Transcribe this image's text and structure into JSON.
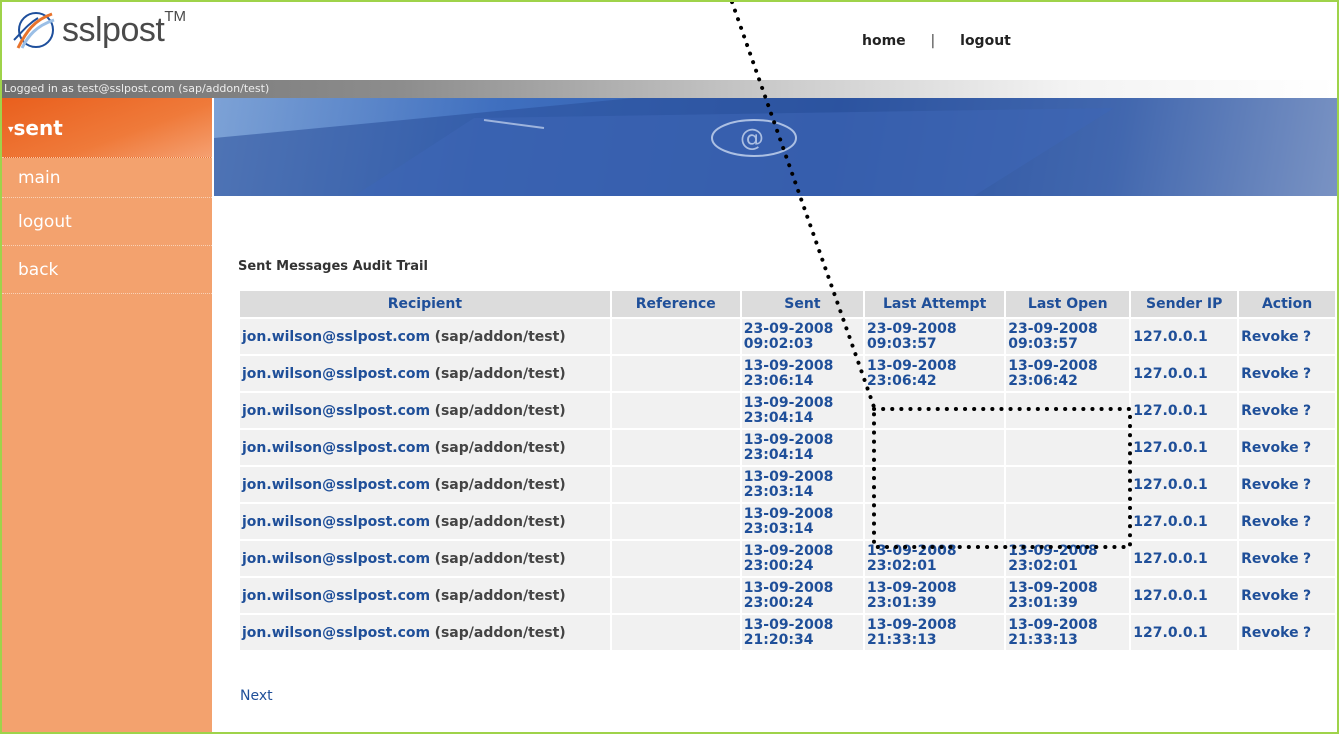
{
  "header": {
    "logo_text": "sslpost",
    "logo_tm": "TM",
    "nav": {
      "home": "home",
      "separator": "|",
      "logout": "logout"
    }
  },
  "login_bar": {
    "text": "Logged in as test@sslpost.com (sap/addon/test)"
  },
  "sidebar": {
    "current": "sent",
    "items": [
      {
        "label": "main"
      },
      {
        "label": "logout"
      },
      {
        "label": "back"
      }
    ]
  },
  "content": {
    "title": "Sent Messages Audit Trail",
    "columns": [
      "Recipient",
      "Reference",
      "Sent",
      "Last Attempt",
      "Last Open",
      "Sender IP",
      "Action"
    ],
    "rows": [
      {
        "email": "jon.wilson@sslpost.com",
        "tag": "(sap/addon/test)",
        "reference": "",
        "sent_date": "23-09-2008",
        "sent_time": "09:02:03",
        "la_date": "23-09-2008",
        "la_time": "09:03:57",
        "lo_date": "23-09-2008",
        "lo_time": "09:03:57",
        "ip": "127.0.0.1",
        "action": "Revoke",
        "help": "?"
      },
      {
        "email": "jon.wilson@sslpost.com",
        "tag": "(sap/addon/test)",
        "reference": "",
        "sent_date": "13-09-2008",
        "sent_time": "23:06:14",
        "la_date": "13-09-2008",
        "la_time": "23:06:42",
        "lo_date": "13-09-2008",
        "lo_time": "23:06:42",
        "ip": "127.0.0.1",
        "action": "Revoke",
        "help": "?"
      },
      {
        "email": "jon.wilson@sslpost.com",
        "tag": "(sap/addon/test)",
        "reference": "",
        "sent_date": "13-09-2008",
        "sent_time": "23:04:14",
        "la_date": "",
        "la_time": "",
        "lo_date": "",
        "lo_time": "",
        "ip": "127.0.0.1",
        "action": "Revoke",
        "help": "?"
      },
      {
        "email": "jon.wilson@sslpost.com",
        "tag": "(sap/addon/test)",
        "reference": "",
        "sent_date": "13-09-2008",
        "sent_time": "23:04:14",
        "la_date": "",
        "la_time": "",
        "lo_date": "",
        "lo_time": "",
        "ip": "127.0.0.1",
        "action": "Revoke",
        "help": "?"
      },
      {
        "email": "jon.wilson@sslpost.com",
        "tag": "(sap/addon/test)",
        "reference": "",
        "sent_date": "13-09-2008",
        "sent_time": "23:03:14",
        "la_date": "",
        "la_time": "",
        "lo_date": "",
        "lo_time": "",
        "ip": "127.0.0.1",
        "action": "Revoke",
        "help": "?"
      },
      {
        "email": "jon.wilson@sslpost.com",
        "tag": "(sap/addon/test)",
        "reference": "",
        "sent_date": "13-09-2008",
        "sent_time": "23:03:14",
        "la_date": "",
        "la_time": "",
        "lo_date": "",
        "lo_time": "",
        "ip": "127.0.0.1",
        "action": "Revoke",
        "help": "?"
      },
      {
        "email": "jon.wilson@sslpost.com",
        "tag": "(sap/addon/test)",
        "reference": "",
        "sent_date": "13-09-2008",
        "sent_time": "23:00:24",
        "la_date": "13-09-2008",
        "la_time": "23:02:01",
        "lo_date": "13-09-2008",
        "lo_time": "23:02:01",
        "ip": "127.0.0.1",
        "action": "Revoke",
        "help": "?"
      },
      {
        "email": "jon.wilson@sslpost.com",
        "tag": "(sap/addon/test)",
        "reference": "",
        "sent_date": "13-09-2008",
        "sent_time": "23:00:24",
        "la_date": "13-09-2008",
        "la_time": "23:01:39",
        "lo_date": "13-09-2008",
        "lo_time": "23:01:39",
        "ip": "127.0.0.1",
        "action": "Revoke",
        "help": "?"
      },
      {
        "email": "jon.wilson@sslpost.com",
        "tag": "(sap/addon/test)",
        "reference": "",
        "sent_date": "13-09-2008",
        "sent_time": "21:20:34",
        "la_date": "13-09-2008",
        "la_time": "21:33:13",
        "lo_date": "13-09-2008",
        "lo_time": "21:33:13",
        "ip": "127.0.0.1",
        "action": "Revoke",
        "help": "?"
      }
    ],
    "next_label": "Next"
  },
  "colors": {
    "frame_border": "#9fd34a",
    "sidebar_bg": "#f3a26e",
    "sidebar_active": "#e95f1d",
    "link_blue": "#1f4f99"
  }
}
